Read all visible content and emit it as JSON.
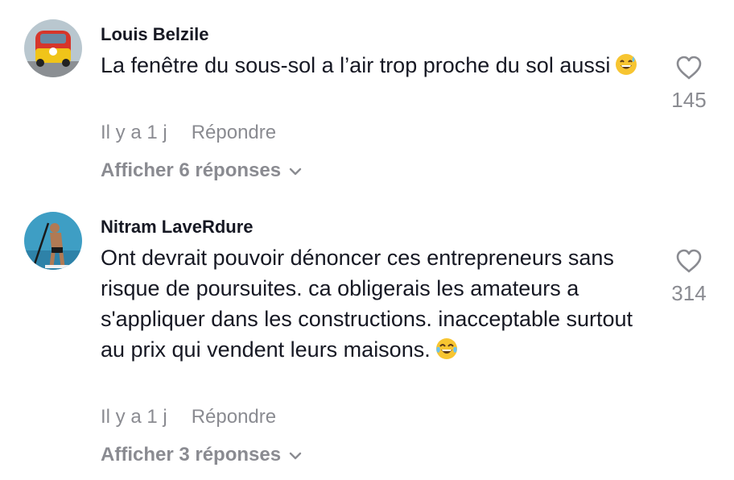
{
  "comments": [
    {
      "author": "Louis Belzile",
      "text": "La fenêtre du sous-sol a l’air trop proche du sol aussi",
      "emoji": "sweat-smile-emoji",
      "time": "Il y a 1 j",
      "reply_label": "Répondre",
      "view_replies": "Afficher 6 réponses",
      "likes": "145"
    },
    {
      "author": "Nitram LaveRdure",
      "text": "Ont devrait pouvoir dénoncer ces entrepreneurs sans risque de poursuites. ca obligerais les amateurs a s'appliquer dans les constructions. inacceptable surtout au prix qui vendent leurs maisons.",
      "emoji": "tears-of-joy-emoji",
      "time": "Il y a 1 j",
      "reply_label": "Répondre",
      "view_replies": "Afficher 3 réponses",
      "likes": "314"
    }
  ],
  "icons": {
    "like": "heart-outline-icon",
    "expand": "chevron-down-icon"
  }
}
